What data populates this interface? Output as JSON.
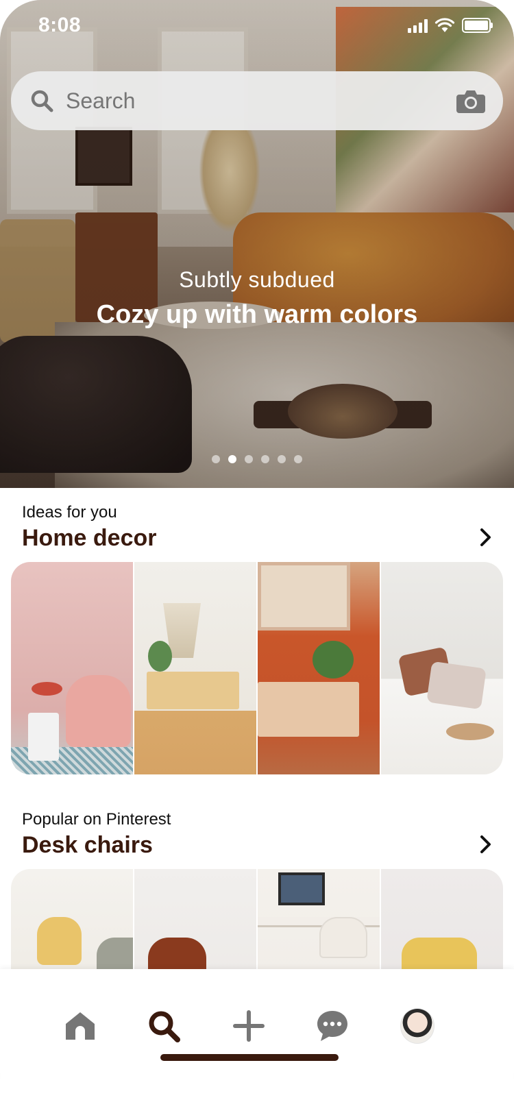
{
  "status_bar": {
    "time": "8:08"
  },
  "search": {
    "placeholder": "Search"
  },
  "hero": {
    "subtitle": "Subtly subdued",
    "title": "Cozy up with warm colors",
    "dots_total": 6,
    "dots_active_index": 1
  },
  "section1": {
    "kicker": "Ideas for you",
    "title": "Home decor"
  },
  "section2": {
    "kicker": "Popular on Pinterest",
    "title": "Desk chairs"
  },
  "tabbar": {
    "items": [
      "home-icon",
      "search-icon",
      "plus-icon",
      "chat-icon",
      "avatar"
    ],
    "active": "search-icon"
  },
  "colors": {
    "accent": "#3a1a0e",
    "tab_icon_inactive": "#767676",
    "search_bg": "#ebebeb"
  }
}
